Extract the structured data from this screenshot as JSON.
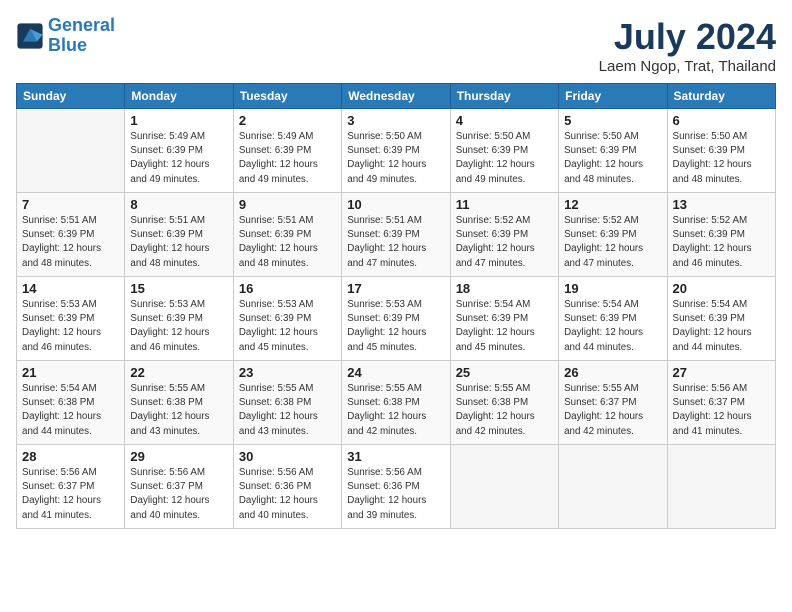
{
  "header": {
    "logo_line1": "General",
    "logo_line2": "Blue",
    "month_title": "July 2024",
    "location": "Laem Ngop, Trat, Thailand"
  },
  "weekdays": [
    "Sunday",
    "Monday",
    "Tuesday",
    "Wednesday",
    "Thursday",
    "Friday",
    "Saturday"
  ],
  "weeks": [
    [
      {
        "day": "",
        "info": ""
      },
      {
        "day": "1",
        "info": "Sunrise: 5:49 AM\nSunset: 6:39 PM\nDaylight: 12 hours\nand 49 minutes."
      },
      {
        "day": "2",
        "info": "Sunrise: 5:49 AM\nSunset: 6:39 PM\nDaylight: 12 hours\nand 49 minutes."
      },
      {
        "day": "3",
        "info": "Sunrise: 5:50 AM\nSunset: 6:39 PM\nDaylight: 12 hours\nand 49 minutes."
      },
      {
        "day": "4",
        "info": "Sunrise: 5:50 AM\nSunset: 6:39 PM\nDaylight: 12 hours\nand 49 minutes."
      },
      {
        "day": "5",
        "info": "Sunrise: 5:50 AM\nSunset: 6:39 PM\nDaylight: 12 hours\nand 48 minutes."
      },
      {
        "day": "6",
        "info": "Sunrise: 5:50 AM\nSunset: 6:39 PM\nDaylight: 12 hours\nand 48 minutes."
      }
    ],
    [
      {
        "day": "7",
        "info": "Sunrise: 5:51 AM\nSunset: 6:39 PM\nDaylight: 12 hours\nand 48 minutes."
      },
      {
        "day": "8",
        "info": "Sunrise: 5:51 AM\nSunset: 6:39 PM\nDaylight: 12 hours\nand 48 minutes."
      },
      {
        "day": "9",
        "info": "Sunrise: 5:51 AM\nSunset: 6:39 PM\nDaylight: 12 hours\nand 48 minutes."
      },
      {
        "day": "10",
        "info": "Sunrise: 5:51 AM\nSunset: 6:39 PM\nDaylight: 12 hours\nand 47 minutes."
      },
      {
        "day": "11",
        "info": "Sunrise: 5:52 AM\nSunset: 6:39 PM\nDaylight: 12 hours\nand 47 minutes."
      },
      {
        "day": "12",
        "info": "Sunrise: 5:52 AM\nSunset: 6:39 PM\nDaylight: 12 hours\nand 47 minutes."
      },
      {
        "day": "13",
        "info": "Sunrise: 5:52 AM\nSunset: 6:39 PM\nDaylight: 12 hours\nand 46 minutes."
      }
    ],
    [
      {
        "day": "14",
        "info": "Sunrise: 5:53 AM\nSunset: 6:39 PM\nDaylight: 12 hours\nand 46 minutes."
      },
      {
        "day": "15",
        "info": "Sunrise: 5:53 AM\nSunset: 6:39 PM\nDaylight: 12 hours\nand 46 minutes."
      },
      {
        "day": "16",
        "info": "Sunrise: 5:53 AM\nSunset: 6:39 PM\nDaylight: 12 hours\nand 45 minutes."
      },
      {
        "day": "17",
        "info": "Sunrise: 5:53 AM\nSunset: 6:39 PM\nDaylight: 12 hours\nand 45 minutes."
      },
      {
        "day": "18",
        "info": "Sunrise: 5:54 AM\nSunset: 6:39 PM\nDaylight: 12 hours\nand 45 minutes."
      },
      {
        "day": "19",
        "info": "Sunrise: 5:54 AM\nSunset: 6:39 PM\nDaylight: 12 hours\nand 44 minutes."
      },
      {
        "day": "20",
        "info": "Sunrise: 5:54 AM\nSunset: 6:39 PM\nDaylight: 12 hours\nand 44 minutes."
      }
    ],
    [
      {
        "day": "21",
        "info": "Sunrise: 5:54 AM\nSunset: 6:38 PM\nDaylight: 12 hours\nand 44 minutes."
      },
      {
        "day": "22",
        "info": "Sunrise: 5:55 AM\nSunset: 6:38 PM\nDaylight: 12 hours\nand 43 minutes."
      },
      {
        "day": "23",
        "info": "Sunrise: 5:55 AM\nSunset: 6:38 PM\nDaylight: 12 hours\nand 43 minutes."
      },
      {
        "day": "24",
        "info": "Sunrise: 5:55 AM\nSunset: 6:38 PM\nDaylight: 12 hours\nand 42 minutes."
      },
      {
        "day": "25",
        "info": "Sunrise: 5:55 AM\nSunset: 6:38 PM\nDaylight: 12 hours\nand 42 minutes."
      },
      {
        "day": "26",
        "info": "Sunrise: 5:55 AM\nSunset: 6:37 PM\nDaylight: 12 hours\nand 42 minutes."
      },
      {
        "day": "27",
        "info": "Sunrise: 5:56 AM\nSunset: 6:37 PM\nDaylight: 12 hours\nand 41 minutes."
      }
    ],
    [
      {
        "day": "28",
        "info": "Sunrise: 5:56 AM\nSunset: 6:37 PM\nDaylight: 12 hours\nand 41 minutes."
      },
      {
        "day": "29",
        "info": "Sunrise: 5:56 AM\nSunset: 6:37 PM\nDaylight: 12 hours\nand 40 minutes."
      },
      {
        "day": "30",
        "info": "Sunrise: 5:56 AM\nSunset: 6:36 PM\nDaylight: 12 hours\nand 40 minutes."
      },
      {
        "day": "31",
        "info": "Sunrise: 5:56 AM\nSunset: 6:36 PM\nDaylight: 12 hours\nand 39 minutes."
      },
      {
        "day": "",
        "info": ""
      },
      {
        "day": "",
        "info": ""
      },
      {
        "day": "",
        "info": ""
      }
    ]
  ]
}
